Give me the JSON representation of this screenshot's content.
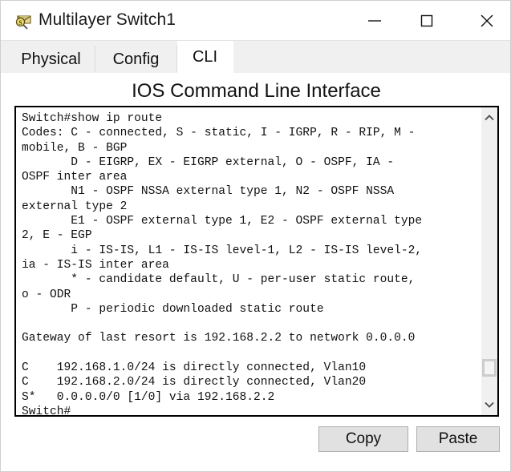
{
  "window": {
    "title": "Multilayer Switch1",
    "icon": "multilayer-switch-icon",
    "controls": {
      "minimize": "minimize-icon",
      "maximize": "maximize-icon",
      "close": "close-icon"
    }
  },
  "tabs": [
    {
      "label": "Physical",
      "selected": false
    },
    {
      "label": "Config",
      "selected": false
    },
    {
      "label": "CLI",
      "selected": true
    }
  ],
  "panel": {
    "heading": "IOS Command Line Interface"
  },
  "terminal": {
    "text": "Switch#show ip route\nCodes: C - connected, S - static, I - IGRP, R - RIP, M -\nmobile, B - BGP\n       D - EIGRP, EX - EIGRP external, O - OSPF, IA -\nOSPF inter area\n       N1 - OSPF NSSA external type 1, N2 - OSPF NSSA\nexternal type 2\n       E1 - OSPF external type 1, E2 - OSPF external type\n2, E - EGP\n       i - IS-IS, L1 - IS-IS level-1, L2 - IS-IS level-2,\nia - IS-IS inter area\n       * - candidate default, U - per-user static route,\no - ODR\n       P - periodic downloaded static route\n\nGateway of last resort is 192.168.2.2 to network 0.0.0.0\n\nC    192.168.1.0/24 is directly connected, Vlan10\nC    192.168.2.0/24 is directly connected, Vlan20\nS*   0.0.0.0/0 [1/0] via 192.168.2.2\nSwitch#",
    "scrollbar": {
      "up_arrow": "chevron-up-icon",
      "down_arrow": "chevron-down-icon",
      "thumb_position_percent": 92
    }
  },
  "actions": {
    "copy_label": "Copy",
    "paste_label": "Paste"
  },
  "colors": {
    "window_background": "#ffffff",
    "tabstrip_background": "#f0f0f0",
    "terminal_border": "#000000",
    "terminal_text": "#111111",
    "button_face": "#e1e1e1",
    "button_border": "#adadad",
    "scrollbar_thumb": "#cdcdcd"
  }
}
